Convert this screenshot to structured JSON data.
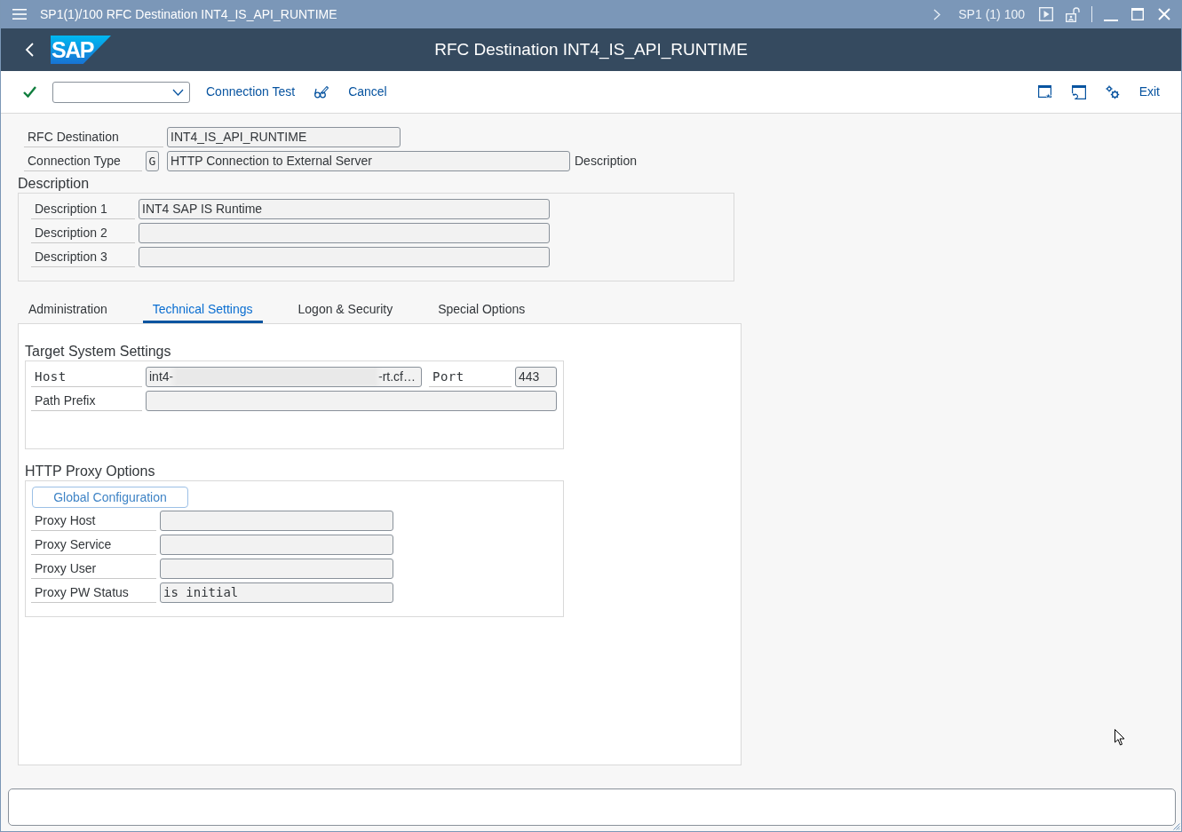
{
  "title_bar": {
    "title": "SP1(1)/100 RFC Destination INT4_IS_API_RUNTIME",
    "system": "SP1 (1) 100"
  },
  "header": {
    "logo": "SAP",
    "title": "RFC Destination INT4_IS_API_RUNTIME"
  },
  "toolbar": {
    "left_buttons": [
      "Connection Test",
      "Cancel"
    ],
    "right_buttons": [
      "Exit"
    ]
  },
  "header_fields": [
    {
      "kind": "plain",
      "label": "RFC Destination",
      "value": "INT4_IS_API_RUNTIME"
    },
    {
      "kind": "coded",
      "label": "Connection Type",
      "code": "G",
      "value": "HTTP Connection to External Server",
      "suffix": "Description"
    }
  ],
  "description_group": {
    "title": "Description",
    "rows": [
      {
        "label": "Description 1",
        "value": "INT4 SAP IS Runtime"
      },
      {
        "label": "Description 2"
      },
      {
        "label": "Description 3"
      }
    ]
  },
  "tabs": [
    {
      "label": "Administration",
      "selected": false
    },
    {
      "label": "Technical Settings",
      "selected": true
    },
    {
      "label": "Logon & Security",
      "selected": false
    },
    {
      "label": "Special Options",
      "selected": false
    }
  ],
  "target_system": {
    "title": "Target System Settings",
    "host": {
      "label": "Host",
      "value_start": "int4-",
      "value_end": "-rt.cf…"
    },
    "port": {
      "label": "Port",
      "value": "443"
    },
    "path_prefix": {
      "label": "Path Prefix"
    }
  },
  "proxy": {
    "title": "HTTP Proxy Options",
    "button": "Global Configuration",
    "rows": [
      {
        "label": "Proxy Host"
      },
      {
        "label": "Proxy Service"
      },
      {
        "label": "Proxy User"
      },
      {
        "label": "Proxy PW Status",
        "value": "is initial"
      }
    ]
  }
}
